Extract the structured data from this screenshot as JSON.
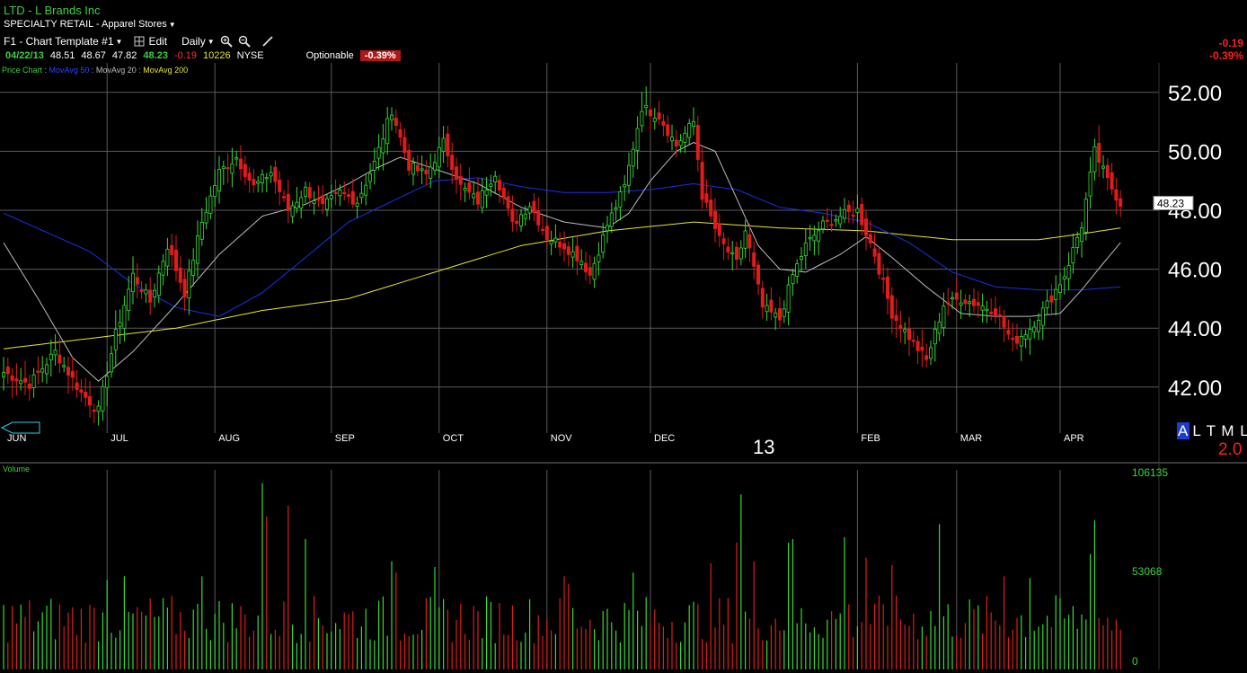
{
  "header": {
    "title": "LTD - L Brands Inc",
    "sector": "SPECIALTY RETAIL - Apparel Stores",
    "template": "F1 - Chart Template #1",
    "edit": "Edit",
    "period": "Daily"
  },
  "quote": {
    "date": "04/22/13",
    "open": "48.51",
    "high": "48.67",
    "low": "47.82",
    "last": "48.23",
    "change": "-0.19",
    "volume": "10226",
    "exchange": "NYSE",
    "optionable": "Optionable",
    "pct": "-0.39%"
  },
  "legend": {
    "price_chart": "Price Chart",
    "sep": " : ",
    "ma50": "MovAvg 50",
    "ma20": "MovAvg 20",
    "ma200": "MovAvg 200"
  },
  "right_change": {
    "abs": "-0.19",
    "pct": "-0.39%"
  },
  "altml": {
    "a": "A",
    "rest": "L T M L",
    "value": "2.0"
  },
  "year_label": "13",
  "volume_label": "Volume",
  "colors": {
    "up": "#33dd33",
    "down": "#e31b1b",
    "ma50": "#1a2fe6",
    "ma20": "#bdbdbd",
    "ma200": "#e6e632",
    "grid": "#5a5a5a",
    "background": "#000000"
  },
  "chart_data": [
    {
      "type": "candlestick",
      "title": "",
      "x": [
        "JUN",
        "JUL",
        "AUG",
        "SEP",
        "OCT",
        "NOV",
        "DEC",
        "FEB",
        "MAR",
        "APR"
      ],
      "ylim": [
        40.5,
        53.0
      ],
      "y_ticks": [
        "52.00",
        "50.00",
        "48.00",
        "46.00",
        "44.00",
        "42.00"
      ],
      "last_price_label": "48.23",
      "anchors": [
        {
          "x": 0,
          "close": 42.5,
          "range": 1.3
        },
        {
          "x": 6,
          "close": 42.1,
          "range": 1.2
        },
        {
          "x": 12,
          "close": 43.2,
          "range": 1.2
        },
        {
          "x": 18,
          "close": 41.8,
          "range": 1.4
        },
        {
          "x": 22,
          "close": 41.2,
          "range": 1.3
        },
        {
          "x": 26,
          "close": 43.8,
          "range": 1.3
        },
        {
          "x": 30,
          "close": 45.8,
          "range": 1.2
        },
        {
          "x": 34,
          "close": 44.9,
          "range": 1.3
        },
        {
          "x": 38,
          "close": 46.8,
          "range": 1.3
        },
        {
          "x": 42,
          "close": 45.2,
          "range": 1.3
        },
        {
          "x": 46,
          "close": 47.6,
          "range": 1.2
        },
        {
          "x": 50,
          "close": 49.3,
          "range": 1.4
        },
        {
          "x": 54,
          "close": 49.8,
          "range": 1.0
        },
        {
          "x": 58,
          "close": 48.8,
          "range": 1.0
        },
        {
          "x": 62,
          "close": 49.3,
          "range": 1.0
        },
        {
          "x": 66,
          "close": 48.0,
          "range": 1.1
        },
        {
          "x": 70,
          "close": 48.7,
          "range": 1.0
        },
        {
          "x": 74,
          "close": 48.1,
          "range": 0.9
        },
        {
          "x": 78,
          "close": 48.6,
          "range": 0.9
        },
        {
          "x": 82,
          "close": 48.3,
          "range": 0.9
        },
        {
          "x": 86,
          "close": 49.6,
          "range": 1.1
        },
        {
          "x": 90,
          "close": 51.4,
          "range": 1.3
        },
        {
          "x": 94,
          "close": 49.5,
          "range": 1.1
        },
        {
          "x": 98,
          "close": 49.2,
          "range": 1.0
        },
        {
          "x": 102,
          "close": 50.3,
          "range": 1.0
        },
        {
          "x": 106,
          "close": 48.8,
          "range": 1.1
        },
        {
          "x": 110,
          "close": 48.3,
          "range": 1.0
        },
        {
          "x": 114,
          "close": 49.3,
          "range": 1.0
        },
        {
          "x": 118,
          "close": 47.5,
          "range": 1.0
        },
        {
          "x": 122,
          "close": 48.2,
          "range": 1.0
        },
        {
          "x": 126,
          "close": 47.1,
          "range": 1.0
        },
        {
          "x": 130,
          "close": 46.8,
          "range": 1.0
        },
        {
          "x": 134,
          "close": 46.3,
          "range": 1.0
        },
        {
          "x": 136,
          "close": 45.8,
          "range": 1.2
        },
        {
          "x": 140,
          "close": 47.5,
          "range": 1.0
        },
        {
          "x": 144,
          "close": 48.8,
          "range": 1.1
        },
        {
          "x": 148,
          "close": 51.5,
          "range": 1.4
        },
        {
          "x": 152,
          "close": 51.2,
          "range": 1.0
        },
        {
          "x": 156,
          "close": 50.2,
          "range": 1.0
        },
        {
          "x": 160,
          "close": 51.0,
          "range": 1.0
        },
        {
          "x": 162,
          "close": 48.5,
          "range": 1.0
        },
        {
          "x": 166,
          "close": 47.0,
          "range": 1.2
        },
        {
          "x": 170,
          "close": 46.2,
          "range": 1.2
        },
        {
          "x": 172,
          "close": 47.3,
          "range": 1.0
        },
        {
          "x": 176,
          "close": 44.7,
          "range": 1.0
        },
        {
          "x": 180,
          "close": 44.3,
          "range": 0.9
        },
        {
          "x": 183,
          "close": 45.8,
          "range": 1.0
        },
        {
          "x": 186,
          "close": 46.8,
          "range": 1.0
        },
        {
          "x": 190,
          "close": 47.5,
          "range": 1.0
        },
        {
          "x": 194,
          "close": 47.8,
          "range": 1.0
        },
        {
          "x": 198,
          "close": 48.0,
          "range": 1.0
        },
        {
          "x": 202,
          "close": 46.5,
          "range": 1.1
        },
        {
          "x": 206,
          "close": 44.5,
          "range": 1.2
        },
        {
          "x": 210,
          "close": 43.7,
          "range": 1.2
        },
        {
          "x": 214,
          "close": 42.9,
          "range": 1.3
        },
        {
          "x": 218,
          "close": 44.8,
          "range": 1.2
        },
        {
          "x": 222,
          "close": 45.0,
          "range": 1.0
        },
        {
          "x": 226,
          "close": 44.8,
          "range": 1.0
        },
        {
          "x": 230,
          "close": 44.6,
          "range": 1.0
        },
        {
          "x": 234,
          "close": 43.5,
          "range": 1.2
        },
        {
          "x": 238,
          "close": 44.0,
          "range": 1.1
        },
        {
          "x": 242,
          "close": 44.8,
          "range": 1.1
        },
        {
          "x": 246,
          "close": 45.8,
          "range": 1.1
        },
        {
          "x": 250,
          "close": 47.5,
          "range": 1.2
        },
        {
          "x": 253,
          "close": 50.0,
          "range": 1.4
        },
        {
          "x": 256,
          "close": 49.0,
          "range": 1.1
        },
        {
          "x": 259,
          "close": 48.23,
          "range": 0.9
        }
      ],
      "moving_averages": {
        "ma50": [
          [
            0,
            47.9
          ],
          [
            20,
            46.6
          ],
          [
            30,
            45.5
          ],
          [
            40,
            44.7
          ],
          [
            50,
            44.4
          ],
          [
            60,
            45.2
          ],
          [
            70,
            46.4
          ],
          [
            80,
            47.6
          ],
          [
            90,
            48.3
          ],
          [
            100,
            49.0
          ],
          [
            110,
            49.1
          ],
          [
            120,
            48.8
          ],
          [
            130,
            48.6
          ],
          [
            140,
            48.6
          ],
          [
            150,
            48.7
          ],
          [
            160,
            48.9
          ],
          [
            170,
            48.7
          ],
          [
            180,
            48.1
          ],
          [
            190,
            47.9
          ],
          [
            200,
            47.6
          ],
          [
            210,
            46.9
          ],
          [
            220,
            45.9
          ],
          [
            230,
            45.4
          ],
          [
            240,
            45.3
          ],
          [
            250,
            45.3
          ],
          [
            259,
            45.4
          ]
        ],
        "ma20": [
          [
            0,
            46.9
          ],
          [
            8,
            45.0
          ],
          [
            16,
            43.0
          ],
          [
            22,
            42.2
          ],
          [
            30,
            43.2
          ],
          [
            40,
            44.8
          ],
          [
            50,
            46.5
          ],
          [
            60,
            47.8
          ],
          [
            70,
            48.2
          ],
          [
            80,
            48.9
          ],
          [
            86,
            49.4
          ],
          [
            92,
            49.8
          ],
          [
            100,
            49.4
          ],
          [
            110,
            48.9
          ],
          [
            120,
            48.1
          ],
          [
            130,
            47.6
          ],
          [
            140,
            47.4
          ],
          [
            145,
            47.9
          ],
          [
            150,
            49.0
          ],
          [
            156,
            50.0
          ],
          [
            160,
            50.3
          ],
          [
            165,
            50.0
          ],
          [
            170,
            48.4
          ],
          [
            175,
            46.8
          ],
          [
            180,
            46.0
          ],
          [
            186,
            45.9
          ],
          [
            194,
            46.5
          ],
          [
            200,
            47.1
          ],
          [
            206,
            46.4
          ],
          [
            214,
            45.4
          ],
          [
            222,
            44.5
          ],
          [
            230,
            44.4
          ],
          [
            238,
            44.4
          ],
          [
            245,
            44.5
          ],
          [
            250,
            45.3
          ],
          [
            255,
            46.2
          ],
          [
            259,
            46.9
          ]
        ],
        "ma200": [
          [
            0,
            43.3
          ],
          [
            40,
            44.0
          ],
          [
            60,
            44.6
          ],
          [
            80,
            45.0
          ],
          [
            100,
            45.9
          ],
          [
            120,
            46.8
          ],
          [
            140,
            47.3
          ],
          [
            160,
            47.6
          ],
          [
            180,
            47.4
          ],
          [
            200,
            47.3
          ],
          [
            220,
            47.0
          ],
          [
            240,
            47.0
          ],
          [
            250,
            47.2
          ],
          [
            259,
            47.4
          ]
        ]
      }
    },
    {
      "type": "bar",
      "title": "Volume",
      "ylim": [
        0,
        106135
      ],
      "y_ticks": [
        "106135",
        "53068",
        "0"
      ]
    }
  ]
}
